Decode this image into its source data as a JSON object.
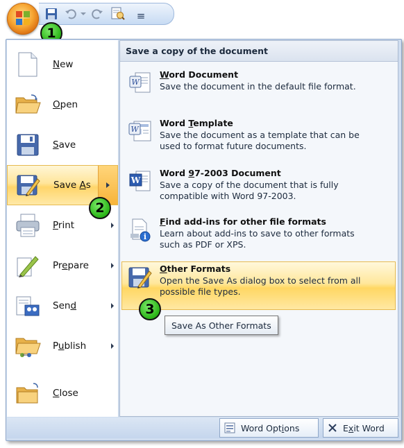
{
  "quick_access_toolbar": {
    "icons": [
      "save-icon",
      "undo-icon",
      "redo-icon",
      "print-preview-icon"
    ],
    "customize_glyph": "≡"
  },
  "office_button": {
    "icon": "office-logo-icon"
  },
  "callouts": [
    "1",
    "2",
    "3"
  ],
  "left_menu": {
    "items": [
      {
        "label": "New",
        "icon": "new-document-icon",
        "has_submenu": false
      },
      {
        "label": "Open",
        "icon": "open-folder-icon",
        "has_submenu": false
      },
      {
        "label": "Save",
        "icon": "floppy-disk-icon",
        "has_submenu": false
      },
      {
        "label": "Save As",
        "icon": "save-as-icon",
        "has_submenu": true,
        "active": true
      },
      {
        "label": "Print",
        "icon": "printer-icon",
        "has_submenu": true
      },
      {
        "label": "Prepare",
        "icon": "prepare-icon",
        "has_submenu": true
      },
      {
        "label": "Send",
        "icon": "send-icon",
        "has_submenu": true
      },
      {
        "label": "Publish",
        "icon": "publish-icon",
        "has_submenu": true
      },
      {
        "label": "Close",
        "icon": "close-folder-icon",
        "has_submenu": false
      }
    ]
  },
  "submenu": {
    "header": "Save a copy of the document",
    "items": [
      {
        "title": "Word Document",
        "description": "Save the document in the default file format.",
        "icon": "word-document-icon"
      },
      {
        "title": "Word Template",
        "description": "Save the document as a template that can be used to format future documents.",
        "icon": "word-template-icon"
      },
      {
        "title": "Word 97-2003 Document",
        "description": "Save a copy of the document that is fully compatible with Word 97-2003.",
        "icon": "word-97-icon"
      },
      {
        "title": "Find add-ins for other file formats",
        "description": "Learn about add-ins to save to other formats such as PDF or XPS.",
        "icon": "add-ins-info-icon"
      },
      {
        "title": "Other Formats",
        "description": "Open the Save As dialog box to select from all possible file types.",
        "icon": "other-formats-icon",
        "highlighted": true
      }
    ]
  },
  "tooltip": {
    "text": "Save As Other Formats"
  },
  "bottom_bar": {
    "word_options": "Word Options",
    "exit_word": "Exit Word"
  },
  "colors": {
    "highlight": "#ffd56a",
    "frame": "#cfddf0",
    "badge_green": "#2fb81c",
    "office_orange": "#f6a431"
  }
}
